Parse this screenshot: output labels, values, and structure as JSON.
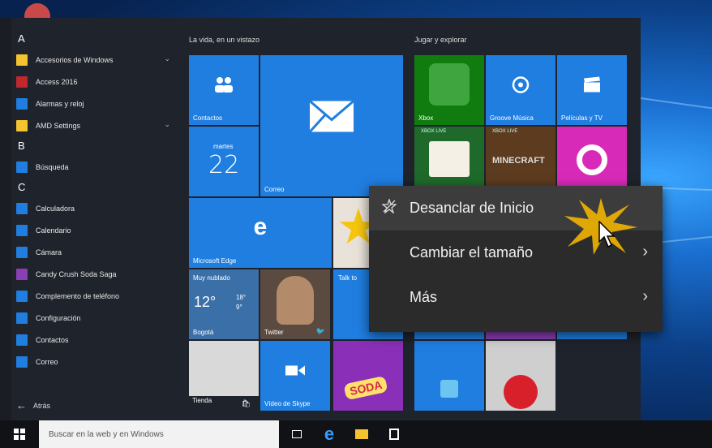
{
  "apps": {
    "sections": [
      {
        "letter": "A",
        "items": [
          {
            "label": "Accesorios de Windows",
            "icon": "folder-icon",
            "color": "#f4c430",
            "expand": true
          },
          {
            "label": "Access 2016",
            "icon": "access-icon",
            "color": "#c1272d",
            "expand": false
          },
          {
            "label": "Alarmas y reloj",
            "icon": "clock-icon",
            "color": "#1f7ee0",
            "expand": false
          },
          {
            "label": "AMD Settings",
            "icon": "folder-icon",
            "color": "#f4c430",
            "expand": true
          }
        ]
      },
      {
        "letter": "B",
        "items": [
          {
            "label": "Búsqueda",
            "icon": "search-icon",
            "color": "#1f7ee0",
            "expand": false
          }
        ]
      },
      {
        "letter": "C",
        "items": [
          {
            "label": "Calculadora",
            "icon": "calculator-icon",
            "color": "#1f7ee0",
            "expand": false
          },
          {
            "label": "Calendario",
            "icon": "calendar-icon",
            "color": "#1f7ee0",
            "expand": false
          },
          {
            "label": "Cámara",
            "icon": "camera-icon",
            "color": "#1f7ee0",
            "expand": false
          },
          {
            "label": "Candy Crush Soda Saga",
            "icon": "candy-icon",
            "color": "#8b3fb5",
            "expand": false
          },
          {
            "label": "Complemento de teléfono",
            "icon": "phone-icon",
            "color": "#1f7ee0",
            "expand": false
          },
          {
            "label": "Configuración",
            "icon": "gear-icon",
            "color": "#1f7ee0",
            "expand": false
          },
          {
            "label": "Contactos",
            "icon": "contacts-icon",
            "color": "#1f7ee0",
            "expand": false
          },
          {
            "label": "Correo",
            "icon": "mail-icon",
            "color": "#1f7ee0",
            "expand": false
          }
        ]
      }
    ],
    "back_label": "Atrás"
  },
  "groups": {
    "life": "La vida, en un vistazo",
    "play": "Jugar y explorar"
  },
  "tiles": {
    "contacts": "Contactos",
    "mail": "Correo",
    "calendar_day": "martes",
    "calendar_date": "22",
    "edge": "Microsoft Edge",
    "weather_desc": "Muy nublado",
    "weather_temp": "12°",
    "weather_hi": "18°",
    "weather_lo": "9°",
    "weather_city": "Bogotá",
    "twitter": "Twitter",
    "talk": "Talk to",
    "store": "Tienda",
    "skype": "Vídeo de Skype",
    "xbox": "Xbox",
    "groove": "Groove Música",
    "movies": "Películas y TV",
    "xboxlive1": "XBOX LIVE",
    "xboxlive2": "XBOX LIVE",
    "minecraft": "MINECRAFT",
    "candy_text": "SODA"
  },
  "context_menu": {
    "items": [
      {
        "label": "Desanclar de Inicio",
        "icon": "unpin-icon",
        "has_arrow": false
      },
      {
        "label": "Cambiar el tamaño",
        "icon": "",
        "has_arrow": true
      },
      {
        "label": "Más",
        "icon": "",
        "has_arrow": true
      }
    ]
  },
  "taskbar": {
    "search_placeholder": "Buscar en la web y en Windows"
  },
  "colors": {
    "accent": "#1f7ee0",
    "menu_bg": "#1f232b",
    "context_bg": "#2b2b2b"
  }
}
